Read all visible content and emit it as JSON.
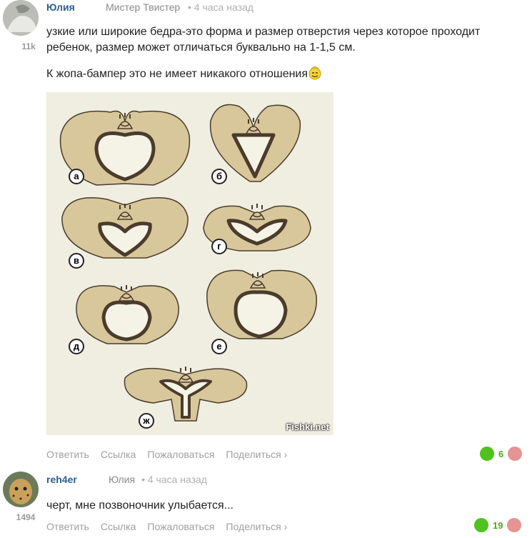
{
  "comments": [
    {
      "author": "Юлия",
      "reply_to": "Мистер Твистер",
      "time": "• 4 часа назад",
      "rating": "11k",
      "paragraphs": [
        "узкие или широкие бедра-это форма и размер отверстия через которое проходит ребенок, размер может отличаться буквально на 1-1,5 см.",
        "К жопа-бампер это не имеет никакого отношения"
      ],
      "image": {
        "labels": [
          "а",
          "б",
          "в",
          "г",
          "д",
          "е",
          "ж"
        ],
        "watermark": "Fishki.net"
      },
      "actions": {
        "reply": "Ответить",
        "link": "Ссылка",
        "report": "Пожаловаться",
        "share": "Поделиться ›"
      },
      "score": "6"
    },
    {
      "author": "reh4er",
      "reply_to": "Юлия",
      "time": "• 4 часа назад",
      "rating": "1494",
      "paragraphs": [
        "черт, мне позвоночник улыбается..."
      ],
      "actions": {
        "reply": "Ответить",
        "link": "Ссылка",
        "report": "Пожаловаться",
        "share": "Поделиться ›"
      },
      "score": "19"
    }
  ],
  "colors": {
    "author": "#2e5f8a",
    "up": "#4fc21e",
    "down": "#e59393",
    "bone": "#d8c79a",
    "outline": "#4a3b2c"
  }
}
